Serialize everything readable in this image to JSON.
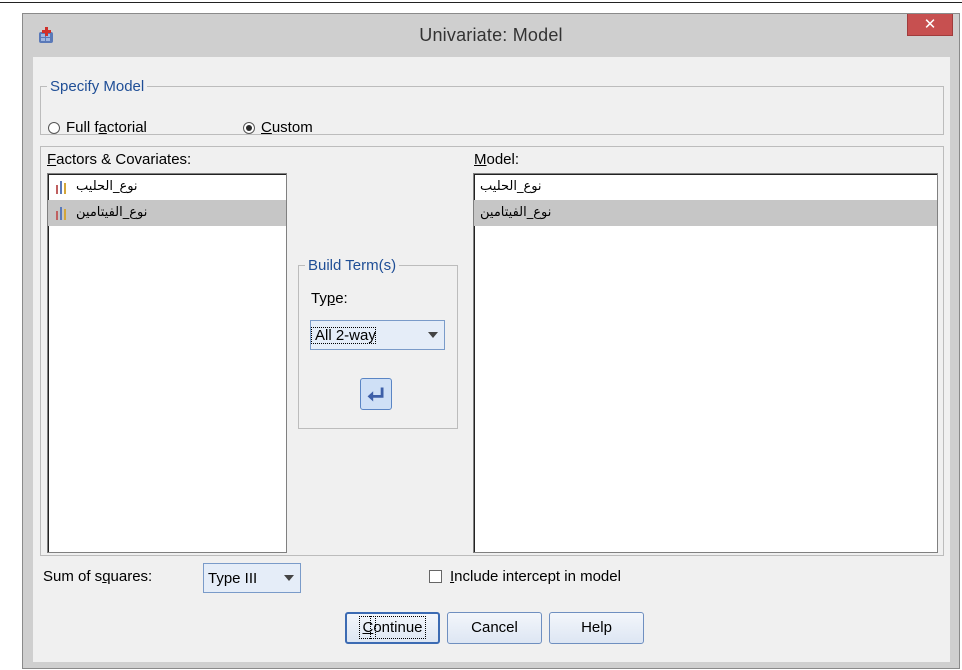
{
  "window": {
    "title": "Univariate: Model",
    "close_glyph": "✕"
  },
  "specify_model": {
    "legend": "Specify Model",
    "full_factorial": {
      "pre": "Full f",
      "ul": "a",
      "post": "ctorial",
      "checked": false
    },
    "custom": {
      "pre": "",
      "ul": "C",
      "post": "ustom",
      "checked": true
    }
  },
  "factors": {
    "label_ul": "F",
    "label_rest": "actors & Covariates:",
    "items": [
      {
        "text": "نوع_الحليب",
        "selected": false,
        "icon": "nominal-variable-icon"
      },
      {
        "text": "نوع_الفيتامين",
        "selected": true,
        "icon": "nominal-variable-icon"
      }
    ]
  },
  "build_terms": {
    "legend": "Build Term(s)",
    "type_pre": "Ty",
    "type_ul": "p",
    "type_post": "e:",
    "type_value": "All 2-way",
    "move_icon": "arrow-left-icon"
  },
  "model": {
    "label_ul": "M",
    "label_rest": "odel:",
    "items": [
      {
        "text": "نوع_الحليب",
        "selected": false
      },
      {
        "text": "نوع_الفيتامين",
        "selected": true
      }
    ]
  },
  "sum_of_squares": {
    "pre": "Sum of s",
    "ul": "q",
    "post": "uares:",
    "value": "Type III"
  },
  "intercept": {
    "ul": "I",
    "rest": "nclude intercept in model",
    "checked": false
  },
  "buttons": {
    "continue_ul": "C",
    "continue_rest": "ontinue",
    "cancel": "Cancel",
    "help": "Help"
  },
  "colors": {
    "legend": "#1f4e96",
    "close": "#c75050",
    "selection": "#c6c6c6",
    "accent": "#3c6bb3"
  }
}
